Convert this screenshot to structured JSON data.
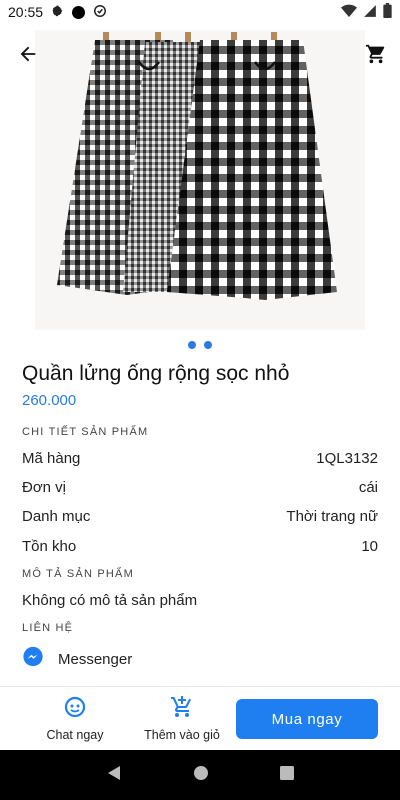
{
  "status_bar": {
    "time": "20:55"
  },
  "product": {
    "title": "Quần lửng ống rộng sọc nhỏ",
    "price": "260.000"
  },
  "details_section": {
    "label": "CHI TIẾT SẢN PHẨM",
    "rows": [
      {
        "key": "Mã hàng",
        "value": "1QL3132"
      },
      {
        "key": "Đơn vị",
        "value": "cái"
      },
      {
        "key": "Danh mục",
        "value": "Thời trang nữ"
      },
      {
        "key": "Tồn kho",
        "value": "10"
      }
    ]
  },
  "description_section": {
    "label": "MÔ TẢ SẢN PHẨM",
    "text": "Không có mô tả sản phẩm"
  },
  "contact_section": {
    "label": "LIÊN HỆ",
    "messenger": "Messenger"
  },
  "bottom_bar": {
    "chat_label": "Chat ngay",
    "add_to_cart_label": "Thêm vào giỏ",
    "buy_label": "Mua ngay"
  },
  "colors": {
    "accent": "#1f7ef0",
    "price": "#2a7ae2"
  },
  "icons": [
    "settings-icon",
    "wifi-icon",
    "battery-icon",
    "back-arrow-icon",
    "cart-icon",
    "messenger-icon",
    "chat-icon",
    "add-cart-icon"
  ]
}
